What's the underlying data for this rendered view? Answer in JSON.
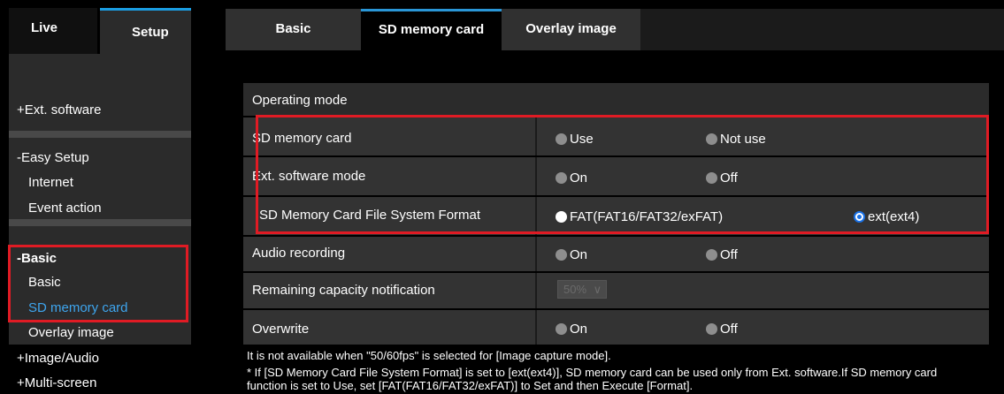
{
  "top_tabs": {
    "live": "Live",
    "setup": "Setup"
  },
  "sidebar": {
    "ext_software": "+Ext. software",
    "easy_setup": "-Easy Setup",
    "internet": "Internet",
    "event_action": "Event action",
    "basic_head": "-Basic",
    "basic": "Basic",
    "sd_memory_card": "SD memory card",
    "overlay_image": "Overlay image",
    "image_audio": "+Image/Audio",
    "multi_screen": "+Multi-screen"
  },
  "tabs": {
    "basic": "Basic",
    "sd_memory_card": "SD memory card",
    "overlay_image": "Overlay image"
  },
  "section_header": "Operating mode",
  "rows": {
    "sd_card": {
      "label": "SD memory card",
      "opt1": "Use",
      "opt2": "Not use"
    },
    "ext_mode": {
      "label": "Ext. software mode",
      "opt1": "On",
      "opt2": "Off"
    },
    "fs_format": {
      "label": "SD Memory Card File System Format",
      "opt1": "FAT(FAT16/FAT32/exFAT)",
      "opt2": "ext(ext4)",
      "selected": "ext(ext4)"
    },
    "audio": {
      "label": "Audio recording",
      "opt1": "On",
      "opt2": "Off"
    },
    "remaining": {
      "label": "Remaining capacity notification",
      "value": "50%"
    },
    "overwrite": {
      "label": "Overwrite",
      "opt1": "On",
      "opt2": "Off"
    }
  },
  "notes": {
    "line1": "It is not available when \"50/60fps\" is selected for [Image capture mode].",
    "line2": "* If [SD Memory Card File System Format] is set to [ext(ext4)], SD memory card can be used only from Ext. software.If SD memory card",
    "line3": "function is set to Use, set [FAT(FAT16/FAT32/exFAT)] to Set and then Execute [Format]."
  },
  "colors": {
    "accent": "#1a9de2",
    "highlight_box": "#e01b24",
    "active_link": "#3ea5ee"
  }
}
